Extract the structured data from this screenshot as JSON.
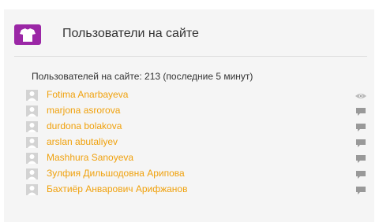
{
  "block": {
    "title": "Пользователи на сайте",
    "title_icon": "users-icon",
    "summary": "Пользователей на сайте: 213 (последние 5 минут)"
  },
  "colors": {
    "accent": "#9b27a6",
    "user_link": "#f0a10c",
    "block_bg": "#f5f5f5",
    "action_icon": "#999999"
  },
  "users": [
    {
      "name": "Fotima Anarbayeva",
      "action_icon": "eye-icon"
    },
    {
      "name": "marjona asrorova",
      "action_icon": "message-icon"
    },
    {
      "name": "durdona bolakova",
      "action_icon": "message-icon"
    },
    {
      "name": "arslan abutaliyev",
      "action_icon": "message-icon"
    },
    {
      "name": "Mashhura Sanoyeva",
      "action_icon": "message-icon"
    },
    {
      "name": "Зулфия Дильшодовна Арипова",
      "action_icon": "message-icon"
    },
    {
      "name": "Бахтиёр Анварович Арифжанов",
      "action_icon": "message-icon"
    }
  ]
}
